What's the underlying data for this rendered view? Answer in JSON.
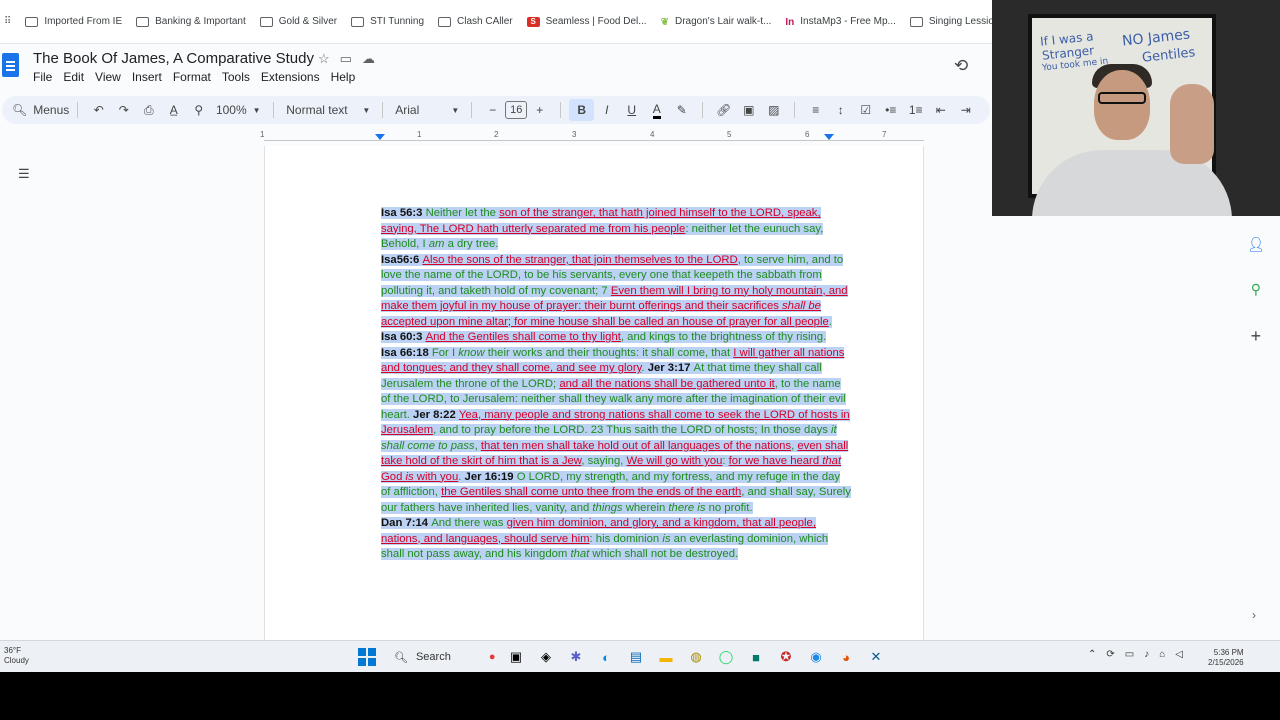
{
  "bookmarks": [
    {
      "label": "Imported From IE",
      "icon": "folder-icon"
    },
    {
      "label": "Banking & Important",
      "icon": "folder-icon"
    },
    {
      "label": "Gold & Silver",
      "icon": "folder-icon"
    },
    {
      "label": "STI Tunning",
      "icon": "folder-icon"
    },
    {
      "label": "Clash CAller",
      "icon": "folder-icon"
    },
    {
      "label": "Seamless | Food Del...",
      "icon": "seamless-icon"
    },
    {
      "label": "Dragon's Lair walk-t...",
      "icon": "dragon-icon"
    },
    {
      "label": "InstaMp3 - Free Mp...",
      "icon": "instamp3-icon"
    },
    {
      "label": "Singing Lessions",
      "icon": "folder-icon"
    }
  ],
  "doc": {
    "title": "The Book Of James, A Comparative Study",
    "menus": [
      "File",
      "Edit",
      "View",
      "Insert",
      "Format",
      "Tools",
      "Extensions",
      "Help"
    ]
  },
  "toolbar": {
    "menus_label": "Menus",
    "zoom": "100%",
    "style": "Normal text",
    "font": "Arial",
    "font_size": "16",
    "bold": "B",
    "italic": "I",
    "underline": "U"
  },
  "ruler": {
    "ticks": [
      "1",
      "1",
      "2",
      "3",
      "4",
      "5",
      "6",
      "7"
    ]
  },
  "content": [
    [
      {
        "t": "Isa 56:3 ",
        "c": "ref"
      },
      {
        "t": "Neither let the "
      },
      {
        "t": "son of the stranger, that hath joined himself to the LORD, ",
        "c": "red"
      },
      {
        "t": "speak, saying, The LORD hath utterly separated me from his people",
        "c": "red"
      },
      {
        "t": ": neither let the eunuch say, Behold, I "
      },
      {
        "t": "am",
        "c": "i"
      },
      {
        "t": " a dry tree."
      }
    ],
    [
      {
        "t": "Isa56:6 ",
        "c": "ref"
      },
      {
        "t": "Also the sons of the stranger, that join themselves to the LORD",
        "c": "red"
      },
      {
        "t": ", to serve him, and to love the name of the LORD, to be his servants, every one that keepeth the sabbath from polluting it, and taketh hold of my covenant; 7 "
      },
      {
        "t": "Even them will I bring to my holy mountain, and make them joyful in my house of prayer: their burnt offerings and their sacrifices ",
        "c": "red"
      },
      {
        "t": "shall be",
        "c": "red i"
      },
      {
        "t": " accepted upon mine altar; for mine house shall be called an house of prayer for all people",
        "c": "red"
      },
      {
        "t": "."
      }
    ],
    [
      {
        "t": "Isa 60:3 ",
        "c": "ref"
      },
      {
        "t": "And the Gentiles shall come to thy light",
        "c": "red"
      },
      {
        "t": ", and kings to the brightness of thy rising."
      }
    ],
    [
      {
        "t": "Isa 66:18 ",
        "c": "ref"
      },
      {
        "t": "For I "
      },
      {
        "t": "know",
        "c": "i"
      },
      {
        "t": " their works and their thoughts: it shall come, that "
      },
      {
        "t": "I will gather all nations and tongues; and they shall come, and see my glory",
        "c": "red"
      },
      {
        "t": ". "
      },
      {
        "t": "Jer 3:17 ",
        "c": "ref"
      },
      {
        "t": "At that time they shall call Jerusalem the throne of the LORD; "
      },
      {
        "t": "and all the nations shall be gathered unto it",
        "c": "red"
      },
      {
        "t": ", to the name of the LORD, to Jerusalem: neither shall they walk any more after the imagination of their evil heart. "
      },
      {
        "t": "Jer 8:22 ",
        "c": "ref"
      },
      {
        "t": "Yea, many people and strong nations shall come to seek the LORD of hosts in Jerusalem",
        "c": "red"
      },
      {
        "t": ", and to pray before the LORD. 23 Thus saith the LORD of hosts; In those days "
      },
      {
        "t": "it shall come to pass",
        "c": "i"
      },
      {
        "t": ", "
      },
      {
        "t": "that ten men shall take hold out of all languages of the nations",
        "c": "red"
      },
      {
        "t": ", "
      },
      {
        "t": "even shall take hold of the skirt of him that is a Jew",
        "c": "red"
      },
      {
        "t": ", saying, "
      },
      {
        "t": "We will go with you",
        "c": "red"
      },
      {
        "t": ": "
      },
      {
        "t": "for we have heard ",
        "c": "red"
      },
      {
        "t": "that",
        "c": "red i"
      },
      {
        "t": " God ",
        "c": "red"
      },
      {
        "t": "is",
        "c": "red i"
      },
      {
        "t": " with you",
        "c": "red"
      },
      {
        "t": ". "
      },
      {
        "t": "Jer 16:19 ",
        "c": "ref"
      },
      {
        "t": "O LORD, my strength, and my fortress, and my refuge in the day of affliction, "
      },
      {
        "t": "the Gentiles shall come unto thee from the ends of the earth",
        "c": "red"
      },
      {
        "t": ", and shall say, Surely our fathers have inherited lies, vanity, and "
      },
      {
        "t": "things",
        "c": "i"
      },
      {
        "t": " wherein "
      },
      {
        "t": "there is",
        "c": "i"
      },
      {
        "t": " no profit."
      }
    ],
    [
      {
        "t": "Dan 7:14 ",
        "c": "ref"
      },
      {
        "t": "And there was "
      },
      {
        "t": "given him dominion, and glory, and a kingdom, that all people, nations, and languages, should serve him",
        "c": "red"
      },
      {
        "t": ": his dominion "
      },
      {
        "t": "is",
        "c": "i"
      },
      {
        "t": " an everlasting dominion, which shall not pass away, and his kingdom "
      },
      {
        "t": "that",
        "c": "i"
      },
      {
        "t": " which shall not be destroyed."
      }
    ]
  ],
  "webcam": {
    "board_lines": [
      "If I was a",
      "Stranger",
      "You took me in",
      "NO James",
      "Gentiles"
    ]
  },
  "taskbar": {
    "weather_temp": "36°F",
    "weather_desc": "Cloudy",
    "search_label": "Search",
    "time": "5:36 PM",
    "date": "2/15/2026"
  }
}
